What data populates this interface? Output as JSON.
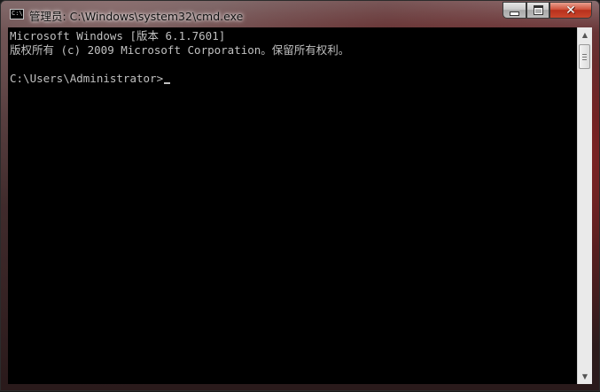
{
  "window": {
    "title": "管理员: C:\\Windows\\system32\\cmd.exe",
    "icon": "cmd-icon",
    "icon_label": "C:\\"
  },
  "controls": {
    "minimize_icon": "minimize-icon",
    "maximize_icon": "maximize-icon",
    "close_symbol": "✕"
  },
  "console": {
    "lines": [
      "Microsoft Windows [版本 6.1.7601]",
      "版权所有 (c) 2009 Microsoft Corporation。保留所有权利。",
      "",
      "C:\\Users\\Administrator>"
    ],
    "text_color": "#c0c0c0",
    "background": "#000000"
  },
  "scrollbar": {
    "up_arrow": "▲",
    "down_arrow": "▼"
  }
}
